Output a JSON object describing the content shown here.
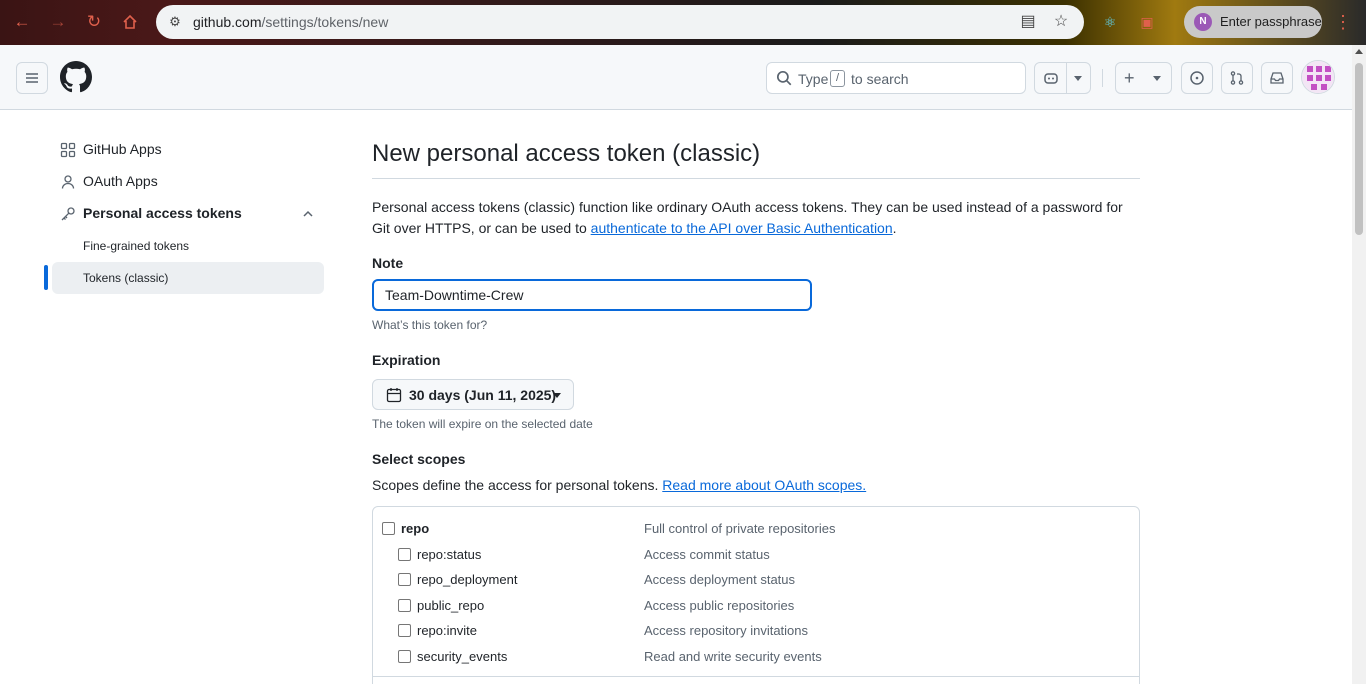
{
  "browser": {
    "url_host": "github.com",
    "url_path": "/settings/tokens/new",
    "profile_label": "Enter passphrase",
    "profile_initial": "N"
  },
  "header": {
    "search_type": "Type",
    "search_slash": "/",
    "search_to": "to search"
  },
  "sidebar": {
    "items": [
      {
        "label": "GitHub Apps",
        "icon": "apps-grid-icon"
      },
      {
        "label": "OAuth Apps",
        "icon": "person-icon"
      },
      {
        "label": "Personal access tokens",
        "icon": "key-icon",
        "expanded": true
      }
    ],
    "subitems": [
      {
        "label": "Fine-grained tokens",
        "active": false
      },
      {
        "label": "Tokens (classic)",
        "active": true
      }
    ]
  },
  "main": {
    "title": "New personal access token (classic)",
    "intro_text": "Personal access tokens (classic) function like ordinary OAuth access tokens. They can be used instead of a password for Git over HTTPS, or can be used to ",
    "intro_link": "authenticate to the API over Basic Authentication",
    "intro_end": ".",
    "note_label": "Note",
    "note_value": "Team-Downtime-Crew",
    "note_hint": "What’s this token for?",
    "expiration_label": "Expiration",
    "expiration_value": "30 days (Jun 11, 2025)",
    "expiration_hint": "The token will expire on the selected date",
    "scopes_label": "Select scopes",
    "scopes_desc": "Scopes define the access for personal tokens. ",
    "scopes_link": "Read more about OAuth scopes.",
    "scopes": [
      {
        "name": "repo",
        "desc": "Full control of private repositories",
        "checked": false,
        "level": 0
      },
      {
        "name": "repo:status",
        "desc": "Access commit status",
        "checked": false,
        "level": 1
      },
      {
        "name": "repo_deployment",
        "desc": "Access deployment status",
        "checked": false,
        "level": 1
      },
      {
        "name": "public_repo",
        "desc": "Access public repositories",
        "checked": false,
        "level": 1
      },
      {
        "name": "repo:invite",
        "desc": "Access repository invitations",
        "checked": false,
        "level": 1
      },
      {
        "name": "security_events",
        "desc": "Read and write security events",
        "checked": false,
        "level": 1
      }
    ]
  },
  "colors": {
    "accent": "#0969da",
    "border": "#d1d9e0",
    "muted_text": "#59636e"
  }
}
